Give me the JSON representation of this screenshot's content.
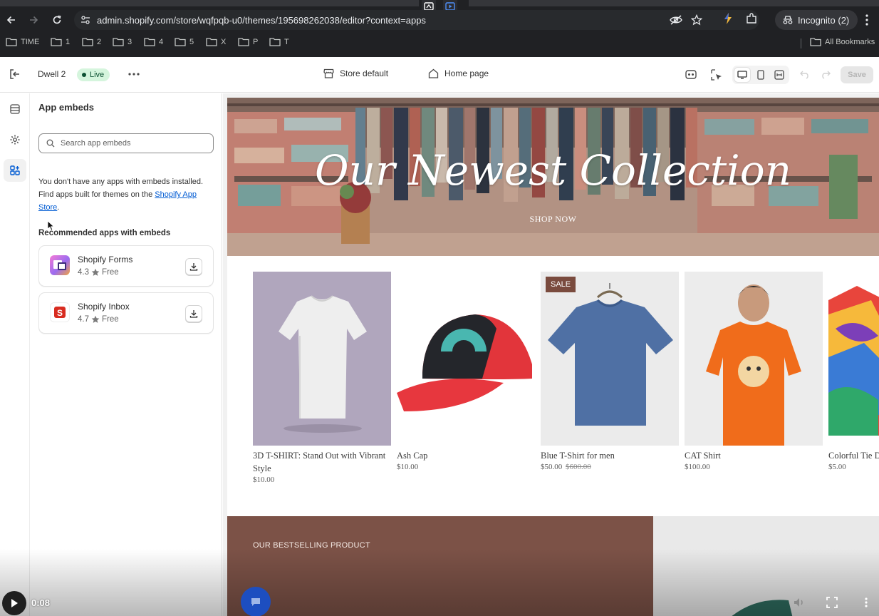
{
  "browser": {
    "url_host": "admin.shopify.com",
    "url_path": "/store/wqfpqb-u0/themes/195698262038/editor?context=apps",
    "profile": "Incognito (2)",
    "bookmarks": [
      "TIME",
      "1",
      "2",
      "3",
      "4",
      "5",
      "X",
      "P",
      "T"
    ],
    "all_bookmarks": "All Bookmarks"
  },
  "editor": {
    "theme_name": "Dwell 2",
    "status": "Live",
    "store_context": "Store default",
    "page_context": "Home page",
    "save_label": "Save"
  },
  "panel": {
    "title": "App embeds",
    "search_placeholder": "Search app embeds",
    "info_text": "You don't have any apps with embeds installed. Find apps built for themes on the ",
    "info_link": "Shopify App Store",
    "info_end": ".",
    "recommended_title": "Recommended apps with embeds",
    "apps": [
      {
        "name": "Shopify Forms",
        "rating": "4.3",
        "price": "Free"
      },
      {
        "name": "Shopify Inbox",
        "rating": "4.7",
        "price": "Free"
      }
    ]
  },
  "store": {
    "hero_title": "Our Newest Collection",
    "hero_cta": "SHOP NOW",
    "products": [
      {
        "name": "3D T-SHIRT: Stand Out with Vibrant Style",
        "price": "$10.00",
        "compare_price": "",
        "badge": ""
      },
      {
        "name": "Ash Cap",
        "price": "$10.00",
        "compare_price": "",
        "badge": ""
      },
      {
        "name": "Blue T-Shirt for men",
        "price": "$50.00",
        "compare_price": "$600.00",
        "badge": "SALE"
      },
      {
        "name": "CAT Shirt",
        "price": "$100.00",
        "compare_price": "",
        "badge": ""
      },
      {
        "name": "Colorful Tie Dye: Vibrant Style",
        "price": "$5.00",
        "compare_price": "",
        "badge": ""
      }
    ],
    "bestselling_label": "OUR BESTSELLING PRODUCT"
  },
  "video": {
    "time": "0:08"
  },
  "colors": {
    "chrome_bg": "#202124",
    "live_green": "#d5f5dd",
    "link_blue": "#005bd3",
    "sale_badge": "#7a4b3e",
    "bestselling_bg": "#7c5247"
  }
}
